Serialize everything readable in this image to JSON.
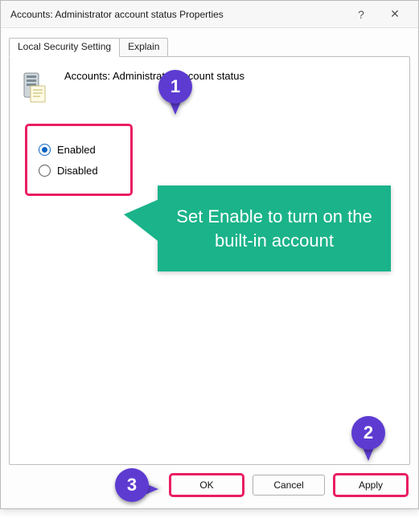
{
  "window": {
    "title": "Accounts: Administrator account status Properties",
    "help_icon": "?",
    "close_icon": "✕"
  },
  "tabs": [
    {
      "label": "Local Security Setting",
      "active": true
    },
    {
      "label": "Explain",
      "active": false
    }
  ],
  "policy": {
    "title": "Accounts: Administrator account status"
  },
  "options": {
    "enabled": "Enabled",
    "disabled": "Disabled",
    "selected": "enabled"
  },
  "buttons": {
    "ok": "OK",
    "cancel": "Cancel",
    "apply": "Apply"
  },
  "annotations": {
    "tip": "Set Enable to turn on the built-in account",
    "step1": "1",
    "step2": "2",
    "step3": "3"
  },
  "colors": {
    "accent_highlight": "#e91e63",
    "callout_bg": "#1bb38a",
    "pin_bg": "#5d3bd1",
    "radio_selected": "#0a63c2"
  }
}
